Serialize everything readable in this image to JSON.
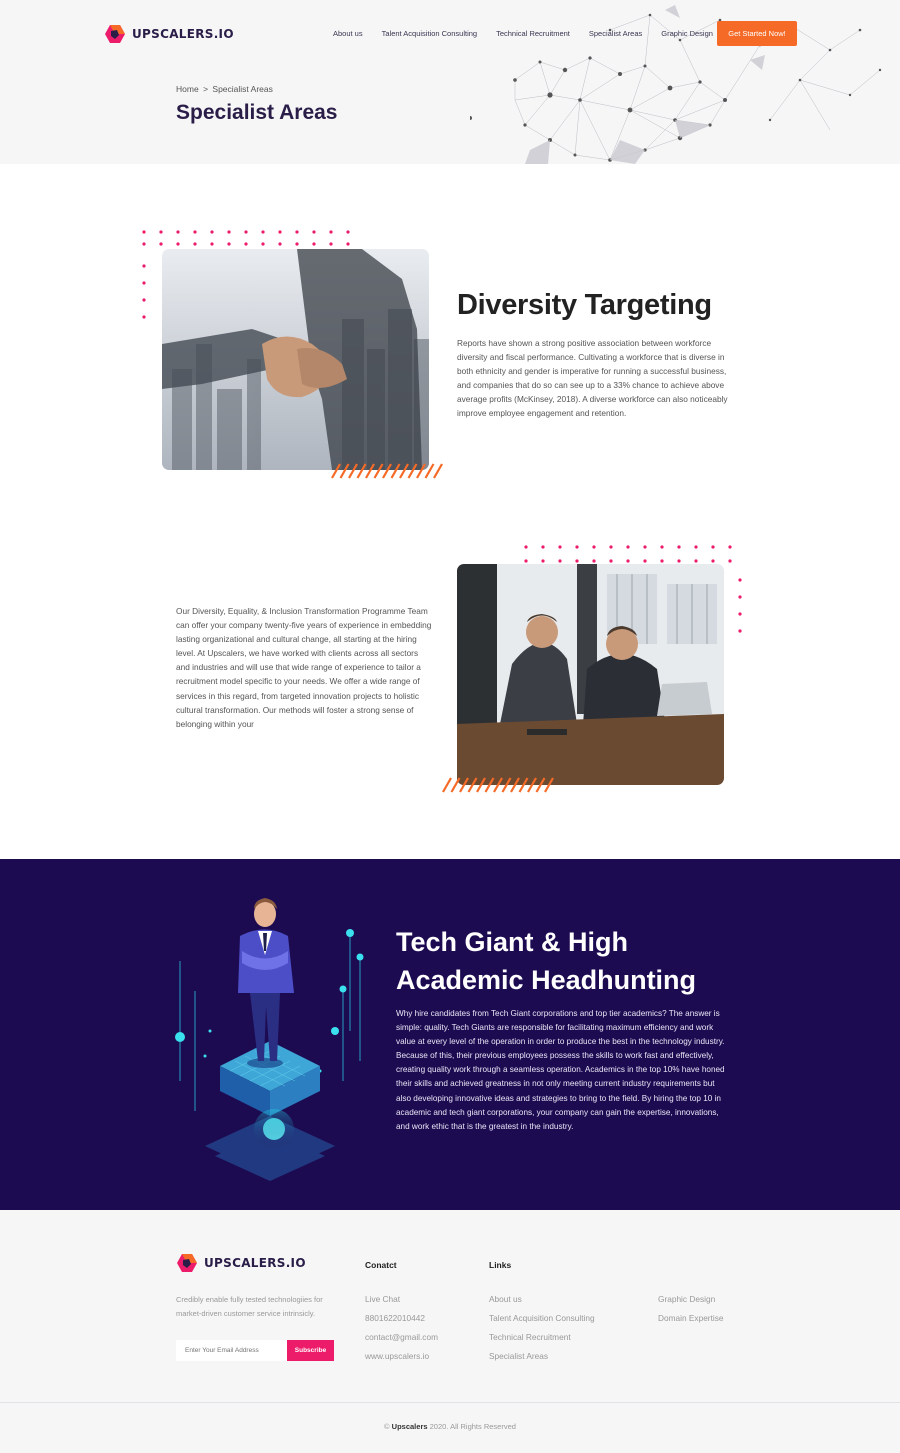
{
  "header": {
    "brand": "UPSCALERS.IO",
    "nav": [
      "About us",
      "Talent Acquisition Consulting",
      "Technical Recruitment",
      "Specialist Areas",
      "Graphic Design"
    ],
    "cta": "Get Started Now!"
  },
  "hero": {
    "breadcrumb_home": "Home",
    "breadcrumb_sep": ">",
    "breadcrumb_current": "Specialist Areas",
    "title": "Specialist Areas"
  },
  "diversity": {
    "title": "Diversity Targeting",
    "body": "Reports have shown a strong positive association between workforce diversity and fiscal performance. Cultivating a workforce that is diverse in both ethnicity and gender is imperative for running a successful business, and companies that do so can see up to a 33% chance to achieve above average profits (McKinsey, 2018). A diverse workforce can also noticeably improve employee engagement and retention."
  },
  "dei": {
    "body": "Our Diversity, Equality, & Inclusion Transformation Programme Team can offer your company twenty-five years of experience in embedding lasting organizational and cultural change, all starting at the hiring level. At Upscalers, we have worked with clients across all sectors and industries and will use that wide range of experience to tailor a recruitment model specific to your needs. We offer a wide range of services in this regard, from targeted innovation projects to holistic cultural transformation. Our methods will foster a strong sense of belonging within your"
  },
  "tech": {
    "title": "Tech Giant & High Academic Headhunting",
    "body": "Why hire candidates from Tech Giant corporations and top tier academics? The answer is simple: quality. Tech Giants are responsible for facilitating maximum efficiency and work value at every level of the operation in order to produce the best in the technology industry. Because of this, their previous employees possess the skills to work fast and effectively, creating quality work through a seamless operation. Academics in the top 10% have honed their skills and achieved greatness in not only meeting current industry requirements but also developing innovative ideas and strategies to bring to the field. By hiring the top 10 in academic and tech giant corporations, your company can gain the expertise, innovations, and work ethic that is the greatest in the industry."
  },
  "footer": {
    "brand": "UPSCALERS.IO",
    "description": "Credibly enable fully tested technologiies for market-driven customer service intrinsicly.",
    "email_placeholder": "Enter Your Email Address",
    "subscribe": "Subscribe",
    "contact_heading": "Conatct",
    "contact": [
      "Live Chat",
      "8801622010442",
      "contact@gmail.com",
      "www.upscalers.io"
    ],
    "links_heading": "Links",
    "links": [
      "About us",
      "Talent Acquisition Consulting",
      "Technical Recruitment",
      "Specialist Areas"
    ],
    "links2": [
      "Graphic Design",
      "Domain Expertise"
    ],
    "copyright_prefix": "©",
    "copyright_brand": "Upscalers",
    "copyright_suffix": "2020. All Rights Reserved"
  },
  "colors": {
    "brand_dark": "#2a1d48",
    "cta_orange": "#f56a26",
    "accent_pink": "#ec1c6b",
    "tech_bg": "#1d0b52"
  }
}
